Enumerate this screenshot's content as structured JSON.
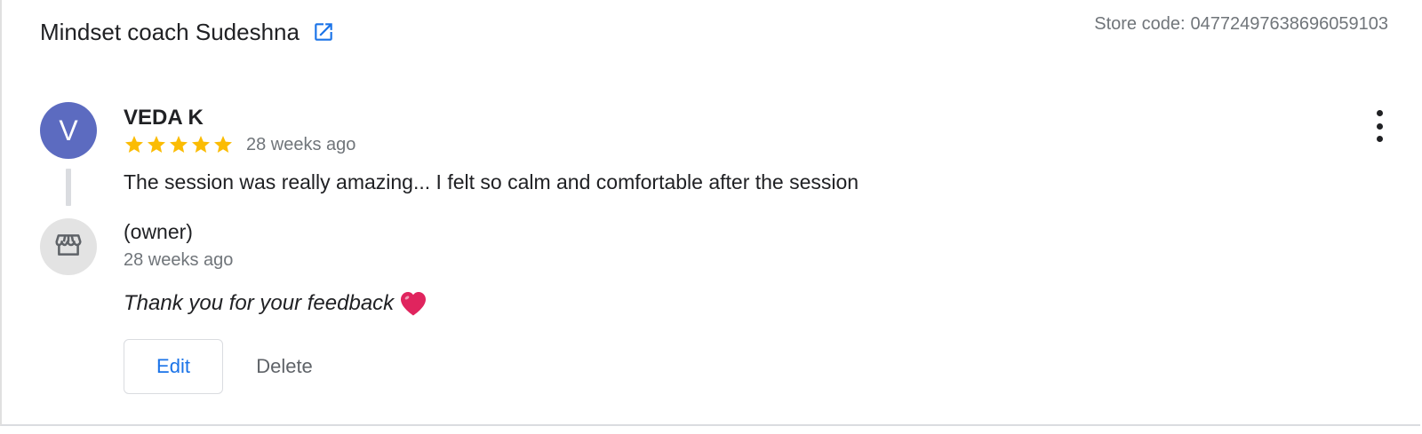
{
  "header": {
    "business_name": "Mindset coach Sudeshna",
    "store_code_label": "Store code:",
    "store_code_value": "04772497638696059103"
  },
  "review": {
    "avatar_initial": "V",
    "reviewer_name": "VEDA K",
    "rating": 5,
    "rating_max": 5,
    "time_ago": "28 weeks ago",
    "text": "The session was really amazing... I felt so calm and comfortable after the session"
  },
  "reply": {
    "owner_label": "(owner)",
    "time_ago": "28 weeks ago",
    "text": "Thank you for your feedback"
  },
  "actions": {
    "edit_label": "Edit",
    "delete_label": "Delete"
  },
  "icons": {
    "external_link": "open-in-new-icon",
    "more": "more-vert-icon",
    "store": "storefront-icon",
    "star": "star-icon",
    "heart": "red-heart-emoji"
  },
  "colors": {
    "link_blue": "#1a73e8",
    "star_gold": "#fbbc04",
    "avatar_purple": "#5c6bc0",
    "heart_red": "#e0245e",
    "secondary_text": "#70757a"
  }
}
